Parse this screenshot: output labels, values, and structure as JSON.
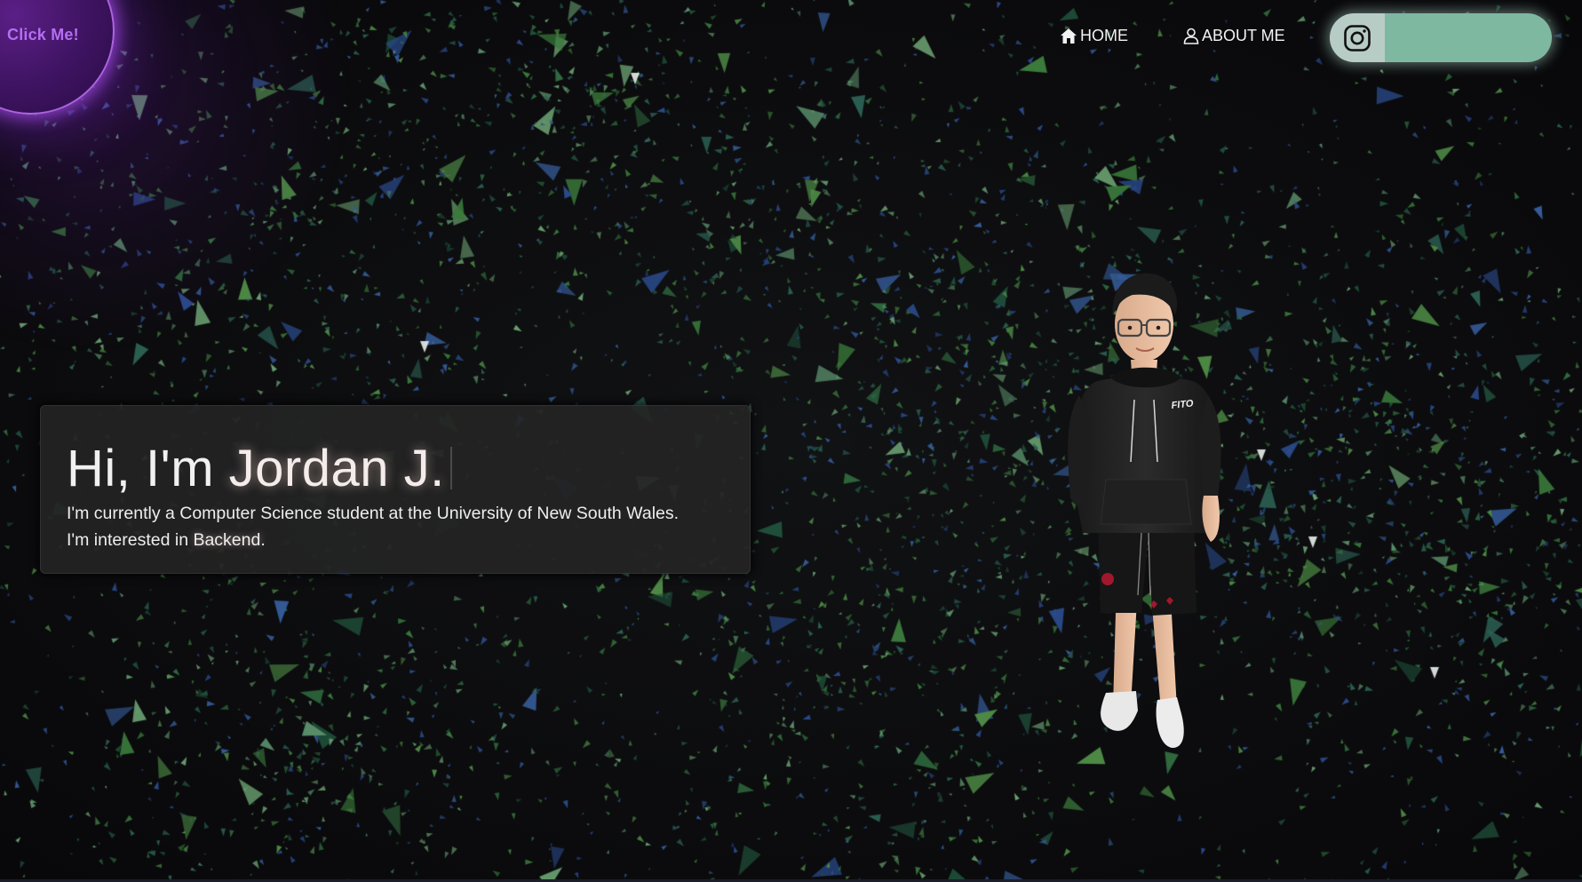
{
  "orb": {
    "label": "Click Me!",
    "color": "#b46ef0"
  },
  "nav": {
    "home_label": "HOME",
    "home_icon": "home-icon",
    "about_label": "ABOUT ME",
    "about_icon": "user-icon",
    "social": {
      "icon": "instagram-icon",
      "pill_color": "#7fb8a0"
    }
  },
  "hero": {
    "greeting": "Hi, I'm ",
    "name": "Jordan J.",
    "line1": "I'm currently a Computer Science student at the University of New South Wales.",
    "line2_prefix": "I'm interested in ",
    "interest": "Backend",
    "line2_suffix": "."
  },
  "avatar": {
    "hoodie_logo": "FITO"
  },
  "colors": {
    "background": "#0d0d0f",
    "particle_green": "#3d7a3a",
    "particle_blue": "#2a4a8a",
    "card_bg": "#242323"
  }
}
